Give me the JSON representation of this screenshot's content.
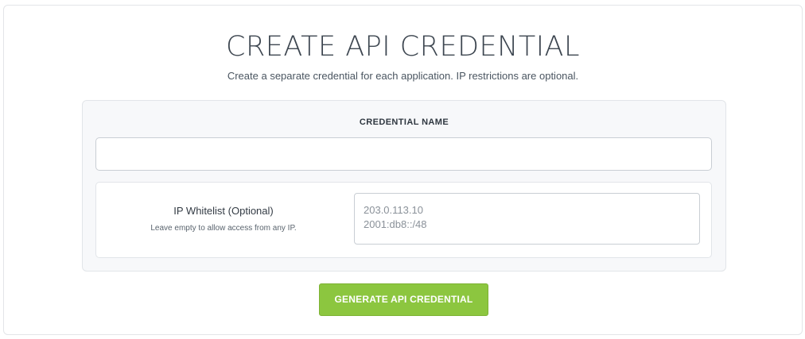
{
  "header": {
    "title": "CREATE API CREDENTIAL",
    "subtitle": "Create a separate credential for each application. IP restrictions are optional."
  },
  "form": {
    "credential_name": {
      "label": "CREDENTIAL NAME",
      "value": ""
    },
    "ip_whitelist": {
      "label": "IP Whitelist (Optional)",
      "hint": "Leave empty to allow access from any IP.",
      "placeholder": "203.0.113.10\n2001:db8::/48"
    },
    "submit_label": "GENERATE API CREDENTIAL"
  },
  "colors": {
    "accent": "#8cc63f",
    "title": "#3d4650",
    "card_background": "#f7f8fa"
  }
}
